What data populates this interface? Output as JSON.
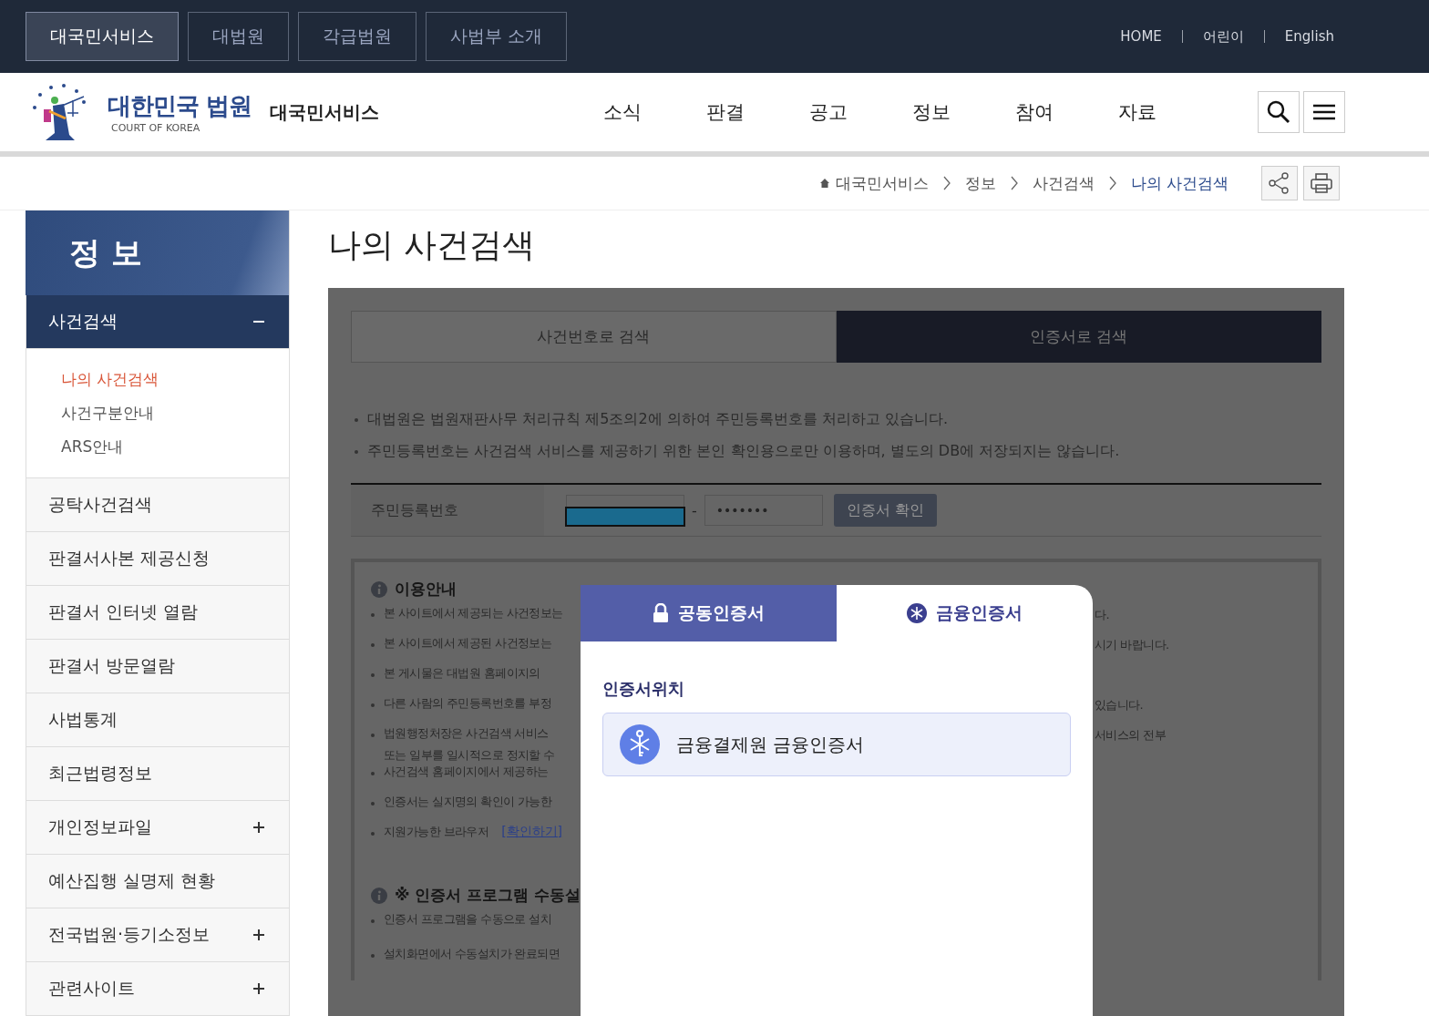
{
  "top_bar": {
    "tabs": [
      {
        "label": "대국민서비스",
        "selected": true
      },
      {
        "label": "대법원",
        "selected": false
      },
      {
        "label": "각급법원",
        "selected": false
      },
      {
        "label": "사법부 소개",
        "selected": false
      }
    ],
    "links": [
      "HOME",
      "어린이",
      "English"
    ]
  },
  "header": {
    "logo_title": "대한민국 법원",
    "logo_subtitle": "COURT OF KOREA",
    "service_name": "대국민서비스",
    "nav": [
      "소식",
      "판결",
      "공고",
      "정보",
      "참여",
      "자료"
    ]
  },
  "breadcrumb": [
    "대국민서비스",
    "정보",
    "사건검색",
    "나의 사건검색"
  ],
  "sidebar": {
    "title": "정 보",
    "items": [
      {
        "label": "사건검색",
        "expanded": true,
        "children": [
          {
            "label": "나의 사건검색",
            "selected": true
          },
          {
            "label": "사건구분안내",
            "selected": false
          },
          {
            "label": "ARS안내",
            "selected": false
          }
        ]
      },
      {
        "label": "공탁사건검색"
      },
      {
        "label": "판결서사본 제공신청"
      },
      {
        "label": "판결서 인터넷 열람"
      },
      {
        "label": "판결서 방문열람"
      },
      {
        "label": "사법통계"
      },
      {
        "label": "최근법령정보"
      },
      {
        "label": "개인정보파일",
        "expanded": false
      },
      {
        "label": "예산집행 실명제 현황"
      },
      {
        "label": "전국법원·등기소정보",
        "expanded": false
      },
      {
        "label": "관련사이트",
        "expanded": false
      }
    ]
  },
  "page_title": "나의 사건검색",
  "search_tabs": [
    {
      "label": "사건번호로 검색",
      "selected": false
    },
    {
      "label": "인증서로 검색",
      "selected": true
    }
  ],
  "notices": [
    "대법원은 법원재판사무 처리규칙 제5조의2에 의하여 주민등록번호를 처리하고 있습니다.",
    "주민등록번호는 사건검색 서비스를 제공하기 위한 본인 확인용으로만 이용하며, 별도의 DB에 저장되지는 않습니다."
  ],
  "form": {
    "label": "주민등록번호",
    "field_1": {
      "highlighted": true
    },
    "separator": "-",
    "field_2": {
      "value": "•••••••"
    },
    "button": "인증서 확인"
  },
  "guide": {
    "title": "이용안내",
    "items": [
      {
        "left": "본 사이트에서 제공되는 사건정보는",
        "right": "다."
      },
      {
        "left": "본 사이트에서 제공된 사건정보는",
        "right": "시기 바랍니다."
      },
      {
        "left": "본 게시물은 대법원 홈페이지의"
      },
      {
        "left": "다른 사람의 주민등록번호를 부정",
        "right": "있습니다."
      },
      {
        "left": "법원행정처장은 사건검색 서비스",
        "right": "서비스의 전부",
        "left_2": "또는 일부를 일시적으로 정지할 수"
      },
      {
        "left": "사건검색 홈페이지에서 제공하는"
      },
      {
        "left": "인증서는 실지명의 확인이 가능한"
      },
      {
        "left": "지원가능한 브라우저",
        "link": "[확인하기]"
      }
    ]
  },
  "manual_install": {
    "title": "※ 인증서 프로그램 수동설",
    "items": [
      {
        "left": "인증서 프로그램을 수동으로 설치"
      },
      {
        "left": "설치화면에서 수동설치가 완료되면"
      }
    ]
  },
  "modal": {
    "tabs": [
      {
        "label": "공동인증서",
        "selected": false
      },
      {
        "label": "금융인증서",
        "selected": true
      }
    ],
    "section_title": "인증서위치",
    "locations": [
      {
        "label": "금융결제원 금융인증서",
        "selected": true
      }
    ]
  }
}
